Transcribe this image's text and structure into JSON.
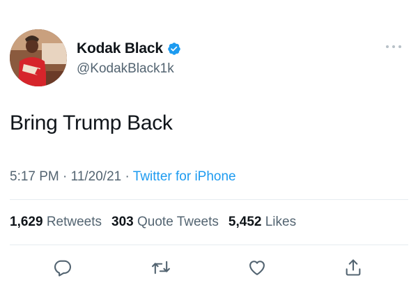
{
  "user": {
    "display_name": "Kodak Black",
    "handle": "@KodakBlack1k",
    "verified_icon": "verified-badge-icon",
    "verified_color": "#1d9bf0"
  },
  "tweet": {
    "text": "Bring Trump Back",
    "time": "5:17 PM",
    "date": "11/20/21",
    "source": "Twitter for iPhone",
    "separator": "·"
  },
  "stats": {
    "retweets_count": "1,629",
    "retweets_label": "Retweets",
    "quotes_count": "303",
    "quotes_label": "Quote Tweets",
    "likes_count": "5,452",
    "likes_label": "Likes"
  },
  "actions": [
    {
      "icon": "reply-icon"
    },
    {
      "icon": "retweet-icon"
    },
    {
      "icon": "like-icon"
    },
    {
      "icon": "share-icon"
    }
  ],
  "colors": {
    "text": "#0f1419",
    "secondary": "#536471",
    "accent": "#1d9bf0",
    "divider": "#e6ecf0"
  }
}
